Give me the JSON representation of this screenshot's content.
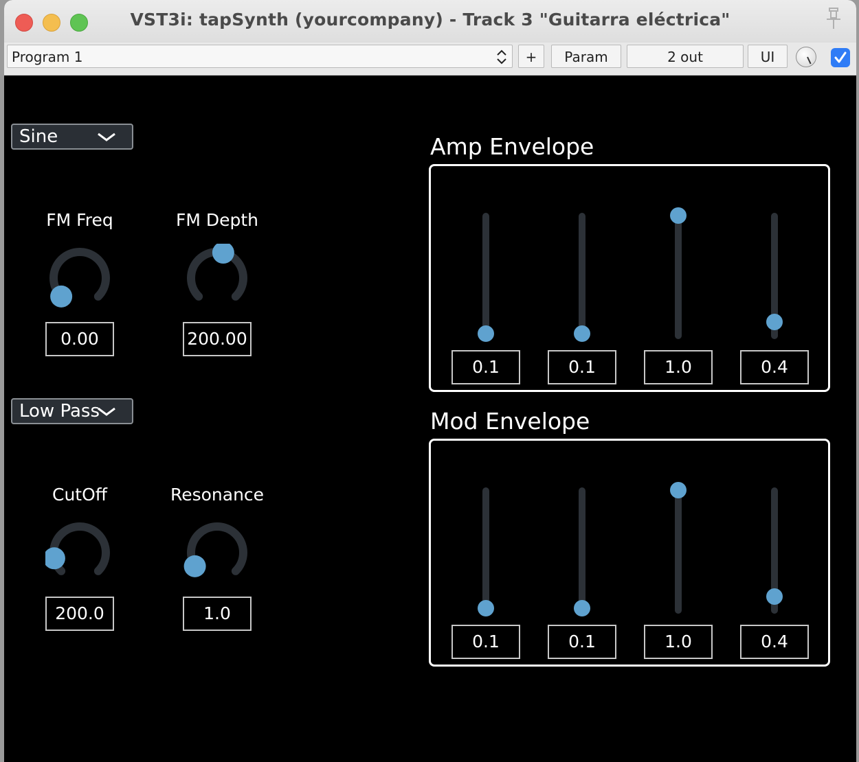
{
  "window": {
    "title": "VST3i: tapSynth (yourcompany) - Track 3 \"Guitarra eléctrica\""
  },
  "toolbar": {
    "program": "Program 1",
    "plus": "+",
    "param": "Param",
    "out": "2 out",
    "ui": "UI",
    "enabled": true
  },
  "oscillator": {
    "waveform": "Sine",
    "fm_freq": {
      "label": "FM Freq",
      "value": "0.00",
      "level": 0.0
    },
    "fm_depth": {
      "label": "FM Depth",
      "value": "200.00",
      "level": 0.55
    }
  },
  "filter": {
    "type": "Low Pass",
    "cutoff": {
      "label": "CutOff",
      "value": "200.0",
      "level": 0.12
    },
    "resonance": {
      "label": "Resonance",
      "value": "1.0",
      "level": 0.05
    }
  },
  "amp_envelope": {
    "title": "Amp Envelope",
    "sliders": [
      {
        "value": "0.1",
        "level": 0.0
      },
      {
        "value": "0.1",
        "level": 0.0
      },
      {
        "value": "1.0",
        "level": 1.0
      },
      {
        "value": "0.4",
        "level": 0.1
      }
    ]
  },
  "mod_envelope": {
    "title": "Mod Envelope",
    "sliders": [
      {
        "value": "0.1",
        "level": 0.0
      },
      {
        "value": "0.1",
        "level": 0.0
      },
      {
        "value": "1.0",
        "level": 1.0
      },
      {
        "value": "0.4",
        "level": 0.1
      }
    ]
  },
  "colors": {
    "accent": "#5fa2cf",
    "track": "#2c3137",
    "background": "#000000"
  }
}
